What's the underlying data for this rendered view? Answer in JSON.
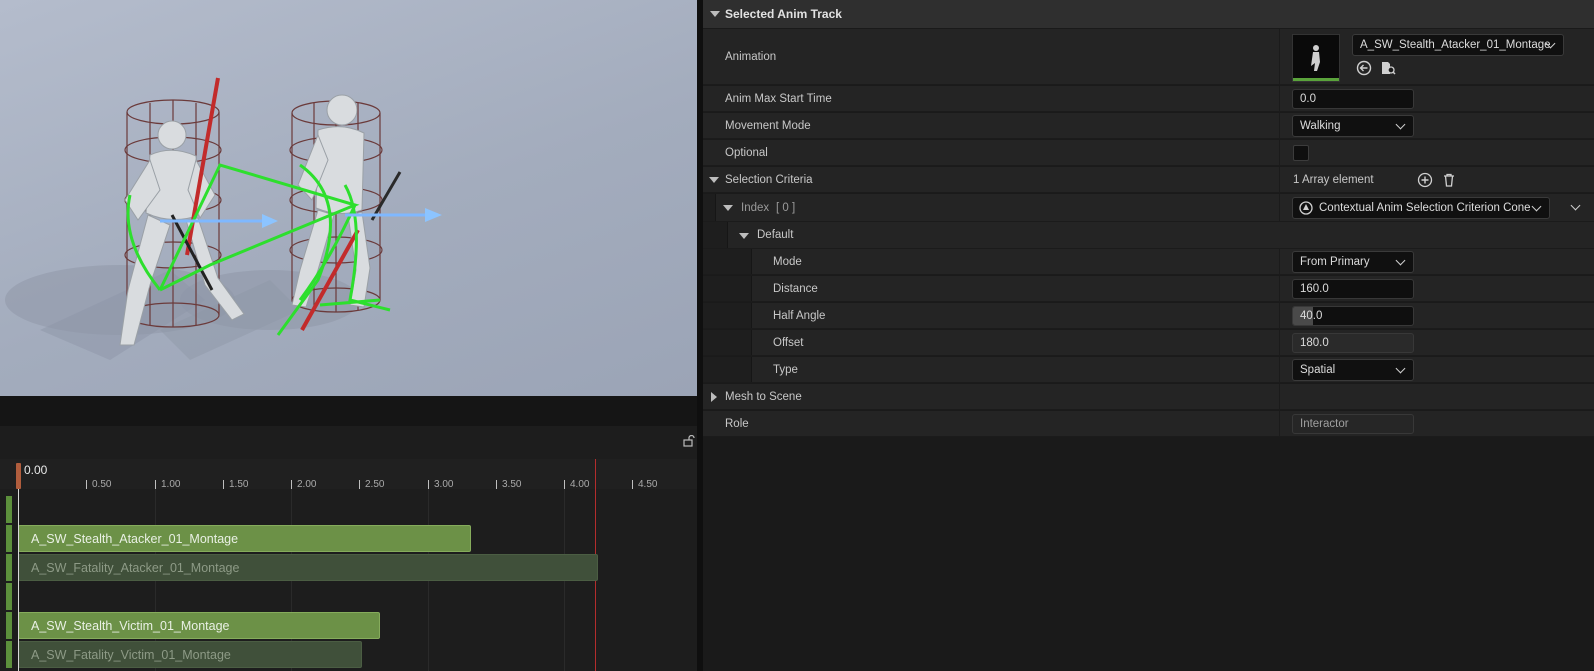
{
  "details": {
    "category_title": "Selected Anim Track",
    "animation": {
      "label": "Animation",
      "value": "A_SW_Stealth_Atacker_01_Montage"
    },
    "anim_max_start_time": {
      "label": "Anim Max Start Time",
      "value": "0.0"
    },
    "movement_mode": {
      "label": "Movement Mode",
      "value": "Walking"
    },
    "optional": {
      "label": "Optional",
      "checked": false
    },
    "selection_criteria": {
      "label": "Selection Criteria",
      "count_text": "1 Array element",
      "index": {
        "label": "Index",
        "bracket": "[ 0 ]",
        "class_value": "Contextual Anim Selection Criterion Cone",
        "default_label": "Default",
        "mode": {
          "label": "Mode",
          "value": "From Primary"
        },
        "distance": {
          "label": "Distance",
          "value": "160.0"
        },
        "half_angle": {
          "label": "Half Angle",
          "value": "40.0"
        },
        "offset": {
          "label": "Offset",
          "value": "180.0"
        },
        "type": {
          "label": "Type",
          "value": "Spatial"
        }
      }
    },
    "mesh_to_scene": {
      "label": "Mesh to Scene"
    },
    "role": {
      "label": "Role",
      "value": "Interactor"
    }
  },
  "timeline": {
    "current_time": "0.00",
    "ticks": [
      "0.50",
      "1.00",
      "1.50",
      "2.00",
      "2.50",
      "3.00",
      "3.50",
      "4.00",
      "4.50"
    ],
    "tracks": [
      {
        "name": "A_SW_Stealth_Atacker_01_Montage",
        "active": true,
        "end_seconds": 3.32
      },
      {
        "name": "A_SW_Fatality_Atacker_01_Montage",
        "active": false,
        "end_seconds": 4.25
      },
      {
        "name": "A_SW_Stealth_Victim_01_Montage",
        "active": true,
        "end_seconds": 2.65
      },
      {
        "name": "A_SW_Fatality_Victim_01_Montage",
        "active": false,
        "end_seconds": 2.52
      }
    ]
  },
  "colors": {
    "active_clip": "#6c9147",
    "inactive_clip": "#40503a",
    "end_marker": "#b32d2d",
    "playhead": "#b05d3d"
  }
}
